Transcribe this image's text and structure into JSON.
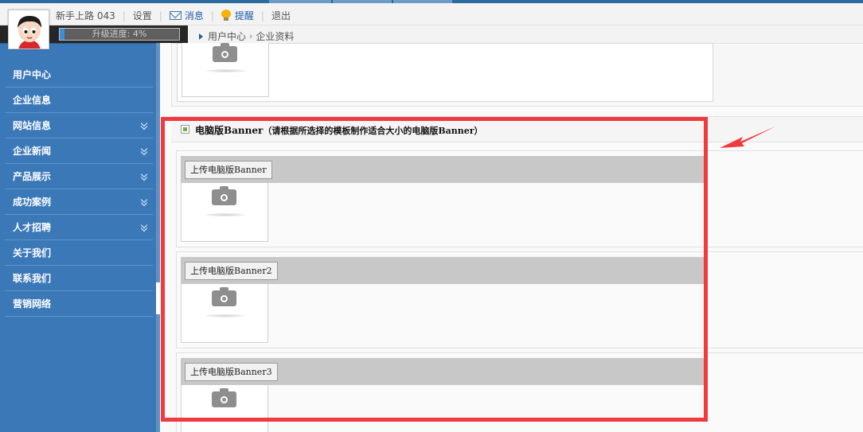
{
  "header": {
    "username": "新手上路 043",
    "settings_label": "设置",
    "messages_label": "消息",
    "reminders_label": "提醒",
    "logout_label": "退出"
  },
  "progress": {
    "text": "升级进度: 4%",
    "value_percent": 4
  },
  "breadcrumb": {
    "home": "用户中心",
    "current": "企业资料"
  },
  "sidebar": {
    "items": [
      {
        "label": "用户中心",
        "expandable": false
      },
      {
        "label": "企业信息",
        "expandable": false
      },
      {
        "label": "网站信息",
        "expandable": true
      },
      {
        "label": "企业新闻",
        "expandable": true
      },
      {
        "label": "产品展示",
        "expandable": true
      },
      {
        "label": "成功案例",
        "expandable": true
      },
      {
        "label": "人才招聘",
        "expandable": true
      },
      {
        "label": "关于我们",
        "expandable": false
      },
      {
        "label": "联系我们",
        "expandable": false
      },
      {
        "label": "营销网络",
        "expandable": false
      }
    ]
  },
  "section": {
    "title": "电脑版Banner",
    "note": "（请根据所选择的模板制作适合大小的电脑版Banner）"
  },
  "uploads": [
    {
      "button_label": "上传电脑版Banner"
    },
    {
      "button_label": "上传电脑版Banner2"
    },
    {
      "button_label": "上传电脑版Banner3"
    }
  ],
  "colors": {
    "sidebar": "#3b78b8",
    "accent": "#1f5fa5",
    "annotation": "#ef3a3f"
  },
  "icons": {
    "avatar": "cartoon-boy-avatar",
    "messages": "mail-icon",
    "reminders": "lightbulb-icon",
    "upload_placeholder": "camera-icon",
    "annotation": "red-arrow"
  }
}
